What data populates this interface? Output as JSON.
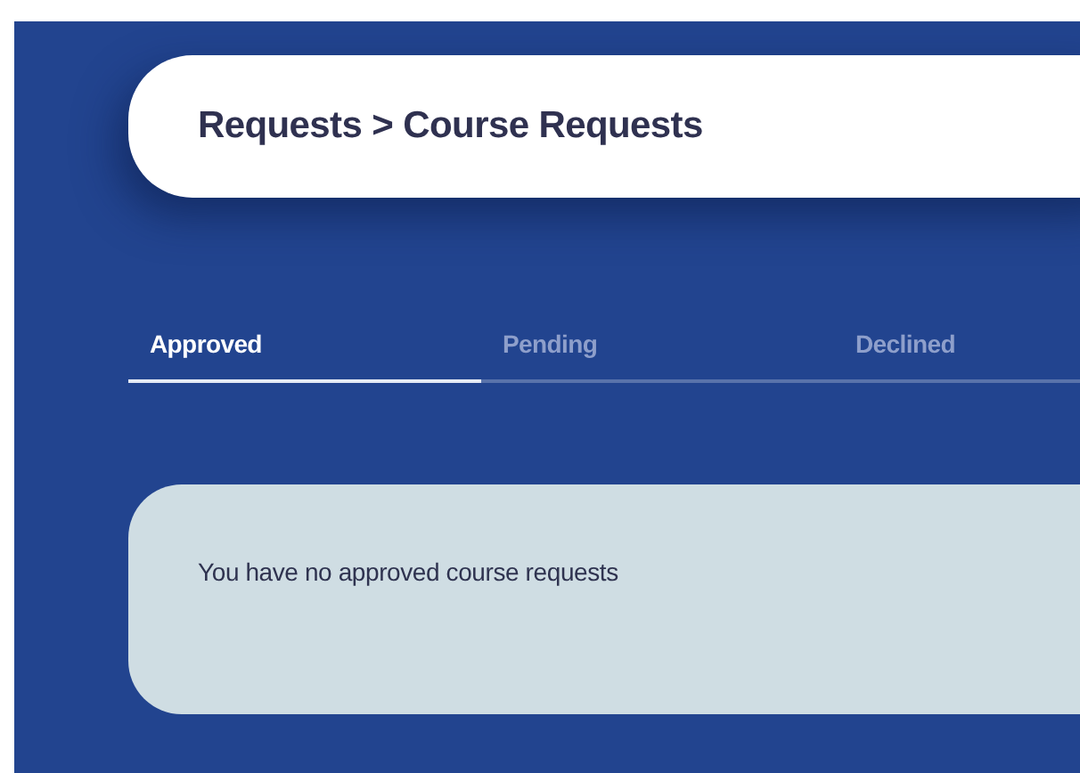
{
  "header": {
    "title": "Requests > Course Requests"
  },
  "tabs": [
    {
      "label": "Approved",
      "selected": true
    },
    {
      "label": "Pending",
      "selected": false
    },
    {
      "label": "Declined",
      "selected": false
    }
  ],
  "message": "You have no approved course requests"
}
